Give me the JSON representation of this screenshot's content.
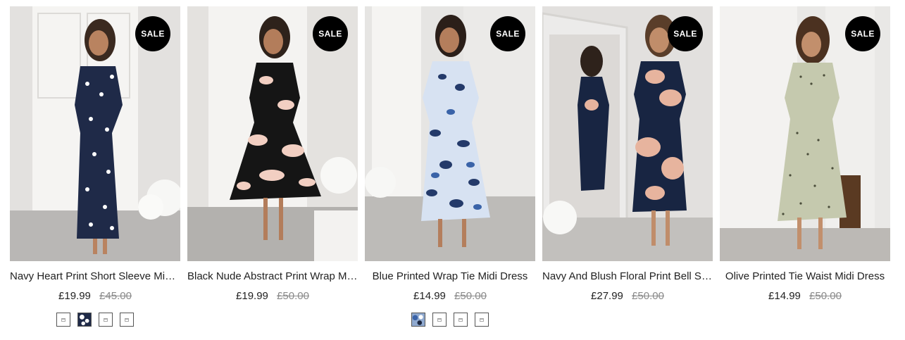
{
  "badge_label": "SALE",
  "products": [
    {
      "title": "Navy Heart Print Short Sleeve Midi Dress",
      "price": "£19.99",
      "was_price": "£45.00",
      "dress_color": "#1f2a48",
      "pattern_color": "#ffffff",
      "swatches": [
        "broken",
        "navy-pattern",
        "broken",
        "broken"
      ]
    },
    {
      "title": "Black Nude Abstract Print Wrap Midi Dress",
      "price": "£19.99",
      "was_price": "£50.00",
      "dress_color": "#151515",
      "pattern_color": "#f2cfc2",
      "swatches": []
    },
    {
      "title": "Blue Printed Wrap Tie Midi Dress",
      "price": "£14.99",
      "was_price": "£50.00",
      "dress_color": "#243a6a",
      "pattern_color": "#d7e2f2",
      "swatches": [
        "blue-pattern",
        "broken",
        "broken",
        "broken"
      ]
    },
    {
      "title": "Navy And Blush Floral Print Bell Sleeve Midi Dress",
      "price": "£27.99",
      "was_price": "£50.00",
      "dress_color": "#182542",
      "pattern_color": "#e7b49e",
      "swatches": []
    },
    {
      "title": "Olive Printed Tie Waist Midi Dress",
      "price": "£14.99",
      "was_price": "£50.00",
      "dress_color": "#c5c9ae",
      "pattern_color": "#4a4d3a",
      "swatches": []
    }
  ]
}
